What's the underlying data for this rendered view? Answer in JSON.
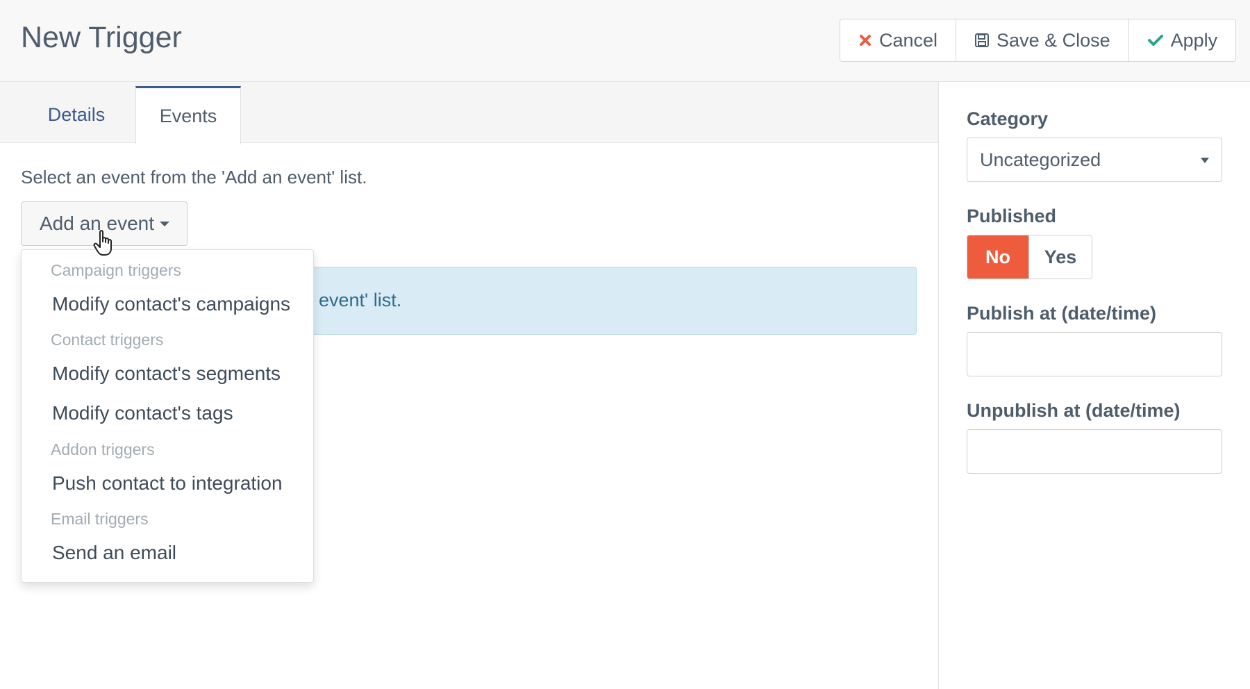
{
  "header": {
    "title": "New Trigger",
    "buttons": {
      "cancel_label": "Cancel",
      "save_close_label": "Save & Close",
      "apply_label": "Apply"
    },
    "icons": {
      "cancel": "times-icon",
      "save": "floppy-disk-icon",
      "apply": "check-icon"
    },
    "colors": {
      "cancel_icon": "#ef5b3d",
      "apply_icon": "#2aa38a"
    }
  },
  "tabs": [
    {
      "label": "Details",
      "active": false
    },
    {
      "label": "Events",
      "active": true
    }
  ],
  "events_panel": {
    "instructions": "Select an event from the 'Add an event' list.",
    "add_event_label": "Add an event",
    "info_text_visible": "event' list.",
    "dropdown": {
      "groups": [
        {
          "header": "Campaign triggers",
          "items": [
            "Modify contact's campaigns"
          ]
        },
        {
          "header": "Contact triggers",
          "items": [
            "Modify contact's segments",
            "Modify contact's tags"
          ]
        },
        {
          "header": "Addon triggers",
          "items": [
            "Push contact to integration"
          ]
        },
        {
          "header": "Email triggers",
          "items": [
            "Send an email"
          ]
        }
      ]
    }
  },
  "sidebar": {
    "category": {
      "label": "Category",
      "value": "Uncategorized"
    },
    "published": {
      "label": "Published",
      "no_label": "No",
      "yes_label": "Yes",
      "selected": "No"
    },
    "publish_at": {
      "label": "Publish at (date/time)",
      "value": ""
    },
    "unpublish_at": {
      "label": "Unpublish at (date/time)",
      "value": ""
    }
  },
  "colors": {
    "accent": "#3d5a8c",
    "danger": "#ef5b3d",
    "info_bg": "#d9ecf5"
  }
}
